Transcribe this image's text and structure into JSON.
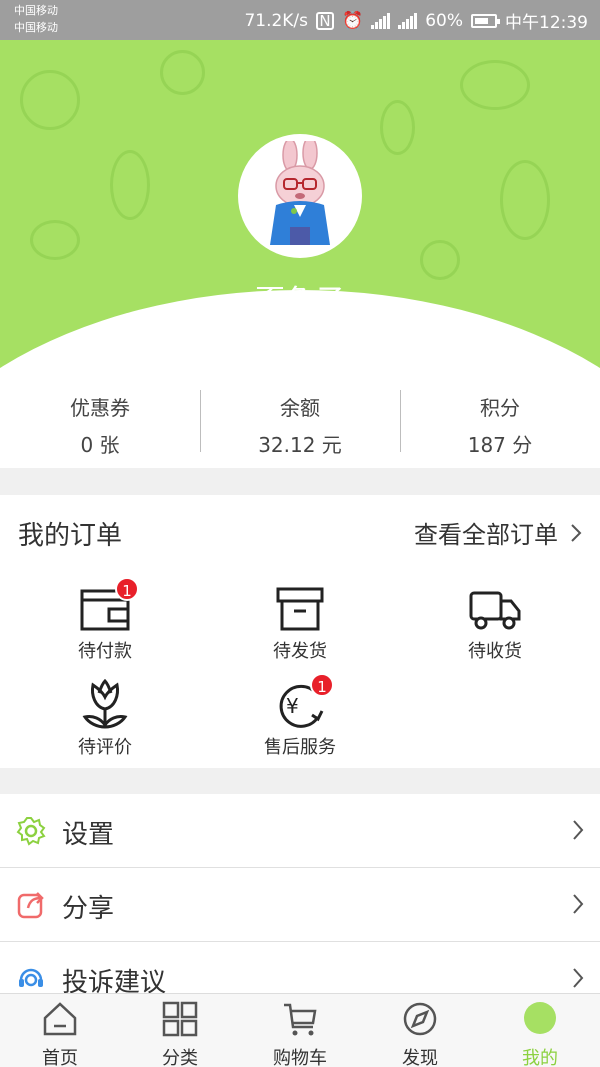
{
  "status_bar": {
    "carrier1": "中国移动",
    "carrier2": "中国移动",
    "speed": "71.2K/s",
    "battery": "60%",
    "time": "中午12:39"
  },
  "profile": {
    "username": "孬兔子",
    "header_color": "#a6e063"
  },
  "stats": [
    {
      "label": "优惠券",
      "value": "0 张"
    },
    {
      "label": "余额",
      "value": "32.12 元"
    },
    {
      "label": "积分",
      "value": "187 分"
    }
  ],
  "orders": {
    "title": "我的订单",
    "view_all": "查看全部订单",
    "items": [
      {
        "label": "待付款",
        "icon": "wallet-icon",
        "badge": "1"
      },
      {
        "label": "待发货",
        "icon": "box-icon",
        "badge": ""
      },
      {
        "label": "待收货",
        "icon": "truck-icon",
        "badge": ""
      },
      {
        "label": "待评价",
        "icon": "flower-icon",
        "badge": ""
      },
      {
        "label": "售后服务",
        "icon": "refund-icon",
        "badge": "1"
      }
    ]
  },
  "menu": [
    {
      "label": "设置",
      "icon": "gear-icon"
    },
    {
      "label": "分享",
      "icon": "share-icon"
    },
    {
      "label": "投诉建议",
      "icon": "headset-icon"
    }
  ],
  "bottom_nav": [
    {
      "label": "首页",
      "icon": "home-icon"
    },
    {
      "label": "分类",
      "icon": "grid-icon"
    },
    {
      "label": "购物车",
      "icon": "cart-icon"
    },
    {
      "label": "发现",
      "icon": "compass-icon"
    },
    {
      "label": "我的",
      "icon": "profile-icon",
      "active": true
    }
  ],
  "colors": {
    "accent": "#8cd140",
    "badge": "#e8202a"
  }
}
